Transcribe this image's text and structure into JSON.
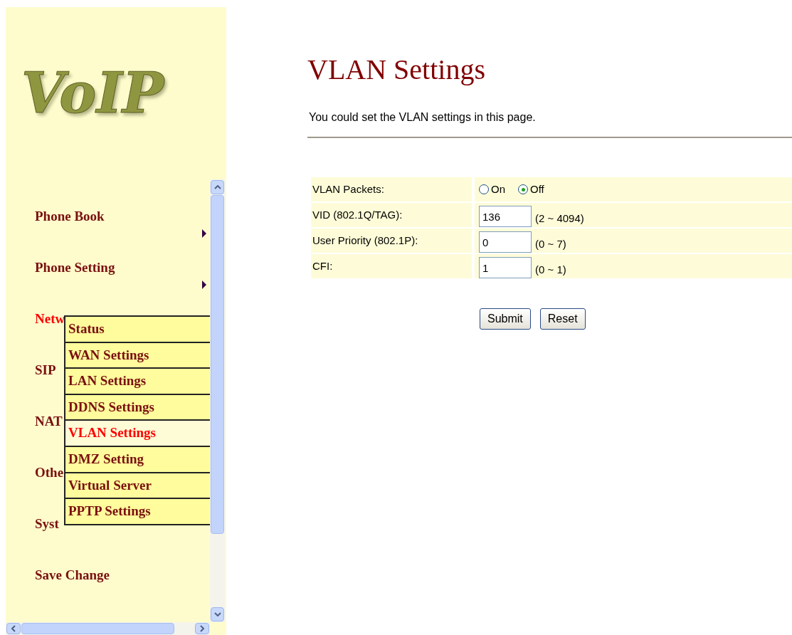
{
  "logo": {
    "text": "VoIP"
  },
  "sidebar": {
    "items": [
      {
        "label": "Phone Book",
        "selected": false,
        "has_submenu": true
      },
      {
        "label": "Phone Setting",
        "selected": false,
        "has_submenu": true
      },
      {
        "label": "Netw",
        "selected": true,
        "has_submenu": false
      },
      {
        "label": "SIP",
        "selected": false,
        "has_submenu": false
      },
      {
        "label": "NAT",
        "selected": false,
        "has_submenu": false
      },
      {
        "label": "Othe",
        "selected": false,
        "has_submenu": false
      },
      {
        "label": "Syst",
        "selected": false,
        "has_submenu": false
      },
      {
        "label": "Save Change",
        "selected": false,
        "has_submenu": false
      }
    ]
  },
  "submenu": {
    "items": [
      {
        "label": "Status",
        "selected": false
      },
      {
        "label": "WAN Settings",
        "selected": false
      },
      {
        "label": "LAN Settings",
        "selected": false
      },
      {
        "label": "DDNS Settings",
        "selected": false
      },
      {
        "label": "VLAN Settings",
        "selected": true
      },
      {
        "label": "DMZ Setting",
        "selected": false
      },
      {
        "label": "Virtual Server",
        "selected": false
      },
      {
        "label": "PPTP Settings",
        "selected": false
      }
    ]
  },
  "page": {
    "title": "VLAN Settings",
    "description": "You could set the VLAN settings in this page."
  },
  "form": {
    "rows": [
      {
        "kind": "radio",
        "label": "VLAN Packets:",
        "options": [
          {
            "label": "On",
            "selected": false
          },
          {
            "label": "Off",
            "selected": true
          }
        ]
      },
      {
        "kind": "input",
        "label": "VID (802.1Q/TAG):",
        "value": "136",
        "range": "(2 ~ 4094)"
      },
      {
        "kind": "input",
        "label": "User Priority (802.1P):",
        "value": "0",
        "range": "(0 ~ 7)"
      },
      {
        "kind": "input",
        "label": "CFI:",
        "value": "1",
        "range": "(0 ~ 1)"
      }
    ]
  },
  "buttons": [
    {
      "label": "Submit"
    },
    {
      "label": "Reset"
    }
  ]
}
